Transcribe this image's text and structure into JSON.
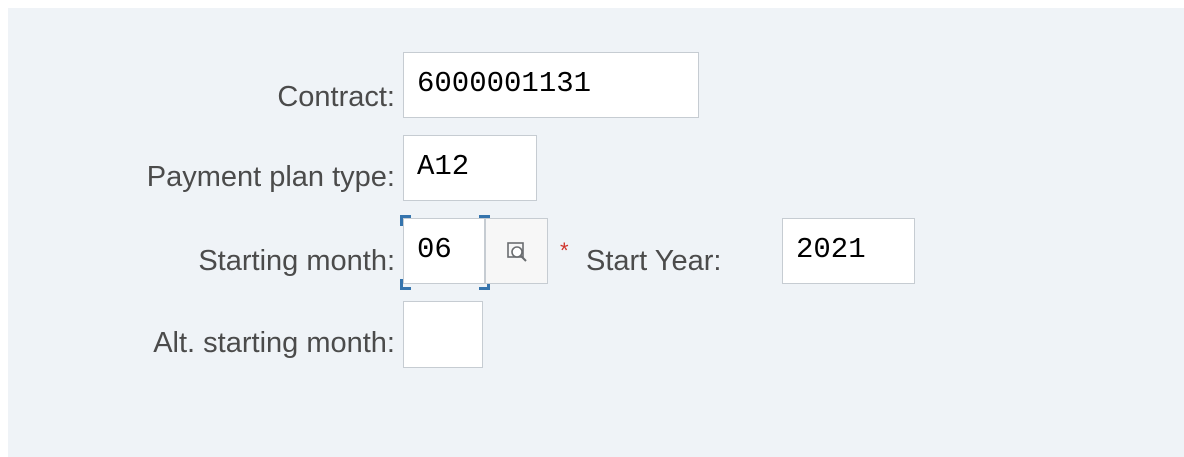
{
  "form": {
    "contract": {
      "label": "Contract:",
      "value": "6000001131"
    },
    "payment_plan_type": {
      "label": "Payment plan type:",
      "value": "A12"
    },
    "starting_month": {
      "label": "Starting month:",
      "value": "06",
      "help_icon": "value-help-icon"
    },
    "start_year": {
      "required_marker": "*",
      "label": "Start Year:",
      "value": "2021"
    },
    "alt_starting_month": {
      "label": "Alt. starting month:",
      "value": ""
    }
  },
  "colors": {
    "panel_background": "#eff3f7",
    "focus_border": "#3574ad",
    "required_marker": "#d0342c"
  }
}
